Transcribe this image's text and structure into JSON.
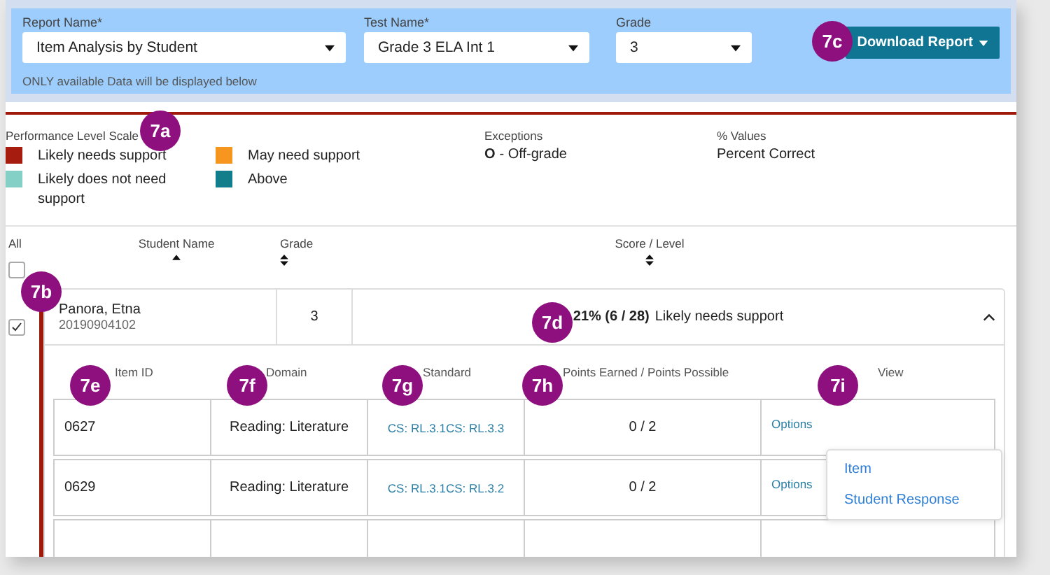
{
  "filters": [
    {
      "label": "Report Name*",
      "value": "Item Analysis by Student"
    },
    {
      "label": "Test Name*",
      "value": "Grade 3 ELA Int 1"
    },
    {
      "label": "Grade",
      "value": "3"
    }
  ],
  "filter_note": "ONLY available Data will be displayed below",
  "download_button": "Download Report",
  "legend": {
    "title": "Performance Level Scale",
    "levels": [
      {
        "label": "Likely needs support",
        "color": "#a61c0e"
      },
      {
        "label": "Likely does not need support",
        "color": "#84cfc6"
      },
      {
        "label": "May need support",
        "color": "#f7961e"
      },
      {
        "label": "Above",
        "color": "#127e8c"
      }
    ]
  },
  "exceptions": {
    "title": "Exceptions",
    "symbol": "O",
    "text": "- Off-grade"
  },
  "percent_values": {
    "title": "% Values",
    "value": "Percent Correct"
  },
  "table": {
    "select_all": "All",
    "select_all_checked": false,
    "columns": [
      {
        "label": "Student Name",
        "kind": "sorted"
      },
      {
        "label": "Grade",
        "kind": "sortable"
      },
      {
        "label": "Score / Level",
        "kind": "sortable"
      }
    ]
  },
  "students": [
    {
      "checked": true,
      "expanded": true,
      "name": "Panora, Etna",
      "id": "20190904102",
      "grade": "3",
      "score": "21% (6 / 28)",
      "level": "Likely needs support",
      "item_columns": [
        "Item ID",
        "Domain",
        "Standard",
        "Points Earned / Points Possible",
        "View"
      ],
      "items": [
        {
          "item_id": "0627",
          "domain": "Reading: Literature",
          "standard": "CS: RL.3.1CS: RL.3.3",
          "points": "0 / 2",
          "view": "Options",
          "menu_open": false
        },
        {
          "item_id": "0629",
          "domain": "Reading: Literature",
          "standard": "CS: RL.3.1CS: RL.3.2",
          "points": "0 / 2",
          "view": "Options",
          "menu_open": true
        }
      ],
      "menu": [
        "Item",
        "Student Response"
      ]
    }
  ],
  "callouts": [
    {
      "label": "7a"
    },
    {
      "label": "7b"
    },
    {
      "label": "7c"
    },
    {
      "label": "7d"
    },
    {
      "label": "7e"
    },
    {
      "label": "7f"
    },
    {
      "label": "7g"
    },
    {
      "label": "7h"
    },
    {
      "label": "7i"
    }
  ]
}
